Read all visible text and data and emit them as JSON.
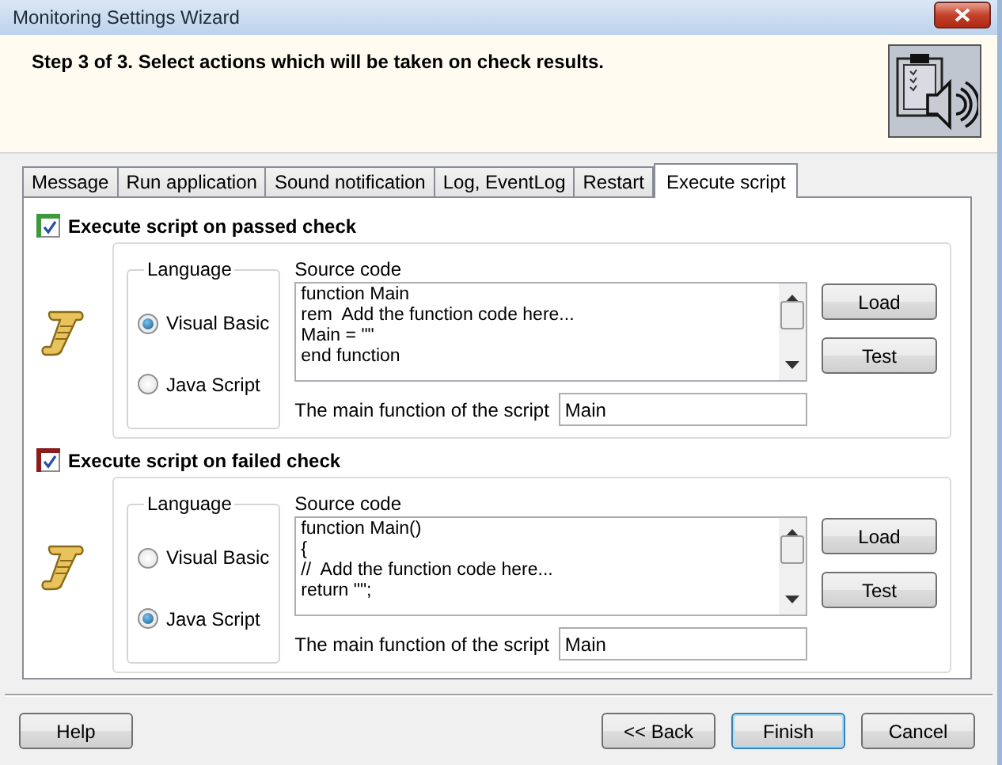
{
  "window": {
    "title": "Monitoring Settings Wizard"
  },
  "header": {
    "text": "Step 3 of 3. Select actions which will be taken on check results."
  },
  "tabs": [
    {
      "label": "Message",
      "selected": false
    },
    {
      "label": "Run application",
      "selected": false
    },
    {
      "label": "Sound notification",
      "selected": false
    },
    {
      "label": "Log, EventLog",
      "selected": false
    },
    {
      "label": "Restart",
      "selected": false
    },
    {
      "label": "Execute script",
      "selected": true
    }
  ],
  "sections": [
    {
      "label": "Execute script on passed check",
      "checked": true,
      "color": "#3c9a3c",
      "language_label": "Language",
      "languages": [
        {
          "label": "Visual Basic",
          "selected": true
        },
        {
          "label": "Java Script",
          "selected": false
        }
      ],
      "source_label": "Source code",
      "source": "function Main\nrem  Add the function code here...\nMain = \"\"\nend function",
      "buttons": [
        "Load",
        "Test"
      ],
      "main_label": "The main function of the script",
      "main_value": "Main"
    },
    {
      "label": "Execute script on failed check",
      "checked": true,
      "color": "#8c1c1c",
      "language_label": "Language",
      "languages": [
        {
          "label": "Visual Basic",
          "selected": false
        },
        {
          "label": "Java Script",
          "selected": true
        }
      ],
      "source_label": "Source code",
      "source": "function Main()\n{\n//  Add the function code here...\nreturn \"\";",
      "buttons": [
        "Load",
        "Test"
      ],
      "main_label": "The main function of the script",
      "main_value": "Main"
    }
  ],
  "buttons": [
    {
      "label": "Help",
      "default": false
    },
    {
      "label": "<< Back",
      "default": false
    },
    {
      "label": "Finish",
      "default": true
    },
    {
      "label": "Cancel",
      "default": false
    }
  ]
}
